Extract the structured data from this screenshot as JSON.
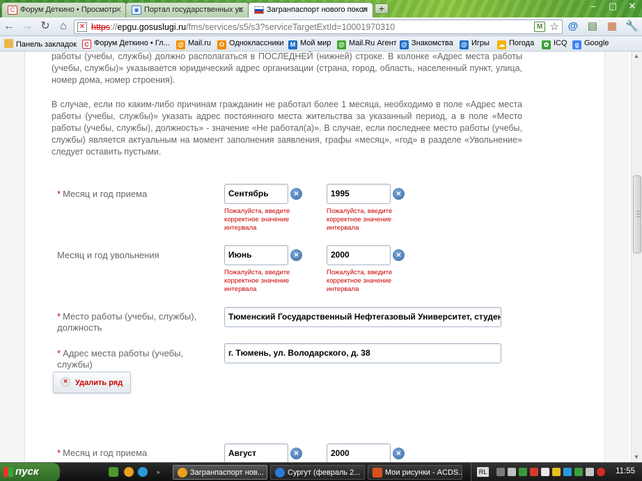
{
  "browser": {
    "tabs": [
      {
        "title": "Форум Деткино • Просмотр",
        "active": false
      },
      {
        "title": "Портал государственных ус",
        "active": false
      },
      {
        "title": "Загранпаспорт нового покол",
        "active": true
      }
    ],
    "new_tab": "+",
    "window_buttons": {
      "minimize": "–",
      "maximize": "▢",
      "close": "✕"
    },
    "nav": {
      "back": "←",
      "forward": "→",
      "reload": "↻",
      "home": "⌂"
    },
    "url": {
      "scheme": "https",
      "separator": "://",
      "host": "epgu.gosuslugi.ru",
      "path": "/fms/services/s5/s3?serviceTargetExtId=10001970310"
    },
    "omnibox_extension": "M",
    "bookmark_star": "☆",
    "toolbar_icons": {
      "mail_agent": "@",
      "chat": "▤",
      "extension": "▦",
      "wrench": "🔧"
    },
    "bookmarks": [
      {
        "label": "Панель закладок",
        "color": "#e8b84a"
      },
      {
        "label": "Форум Деткино • Гл...",
        "color": "#ffffff"
      },
      {
        "label": "Mail.ru",
        "color": "#f29100"
      },
      {
        "label": "Одноклассники",
        "color": "#f28a00"
      },
      {
        "label": "Мой мир",
        "color": "#1e6ec8"
      },
      {
        "label": "Mail.Ru Агент",
        "color": "#41a62a"
      },
      {
        "label": "Знакомства",
        "color": "#1e6ec8"
      },
      {
        "label": "Игры",
        "color": "#1e6ec8"
      },
      {
        "label": "Погода",
        "color": "#f5b400"
      },
      {
        "label": "ICQ",
        "color": "#3aa13a"
      },
      {
        "label": "Google",
        "color": "#4285f4"
      }
    ]
  },
  "page": {
    "paragraph1": "работы (учебы, службы) должно располагаться в ПОСЛЕДНЕЙ (нижней) строке. В колонке «Адрес места работы (учебы, службы)» указывается юридический адрес организации (страна, город, область, населенный пункт, улица, номер дома, номер строения).",
    "paragraph2": "В случае, если по каким-либо причинам гражданин не работал более 1 месяца, необходимо в поле «Адрес места работы (учебы, службы)» указать адрес постоянного места жительства за указанный период, а в поле «Место работы (учебы, службы), должность» - значение «Не работал(а)». В случае, если последнее место работы (учебы, службы) является актуальным на момент заполнения заявления, графы «месяц», «год» в разделе «Увольнение» следует оставить пустыми.",
    "required_mark": "*",
    "clear_glyph": "×",
    "error_text": "Пожалуйста, введите корректное значение интервала",
    "block1": {
      "hire_label": "Месяц и год приема",
      "hire_month": "Сентябрь",
      "hire_year": "1995",
      "fire_label": "Месяц и год увольнения",
      "fire_month": "Июнь",
      "fire_year": "2000",
      "workplace_label": "Место работы (учебы, службы), должность",
      "workplace_value": "Тюменский Государственный Нефтегазовый Университет, студент",
      "address_label": "Адрес места работы (учебы, службы)",
      "address_value": "г. Тюмень, ул. Володарского, д. 38",
      "delete_row": "Удалить ряд",
      "delete_glyph": "×"
    },
    "block2": {
      "hire_label": "Месяц и год приема",
      "hire_month": "Август",
      "hire_year": "2000"
    }
  },
  "taskbar": {
    "start": "пуск",
    "items": [
      {
        "label": "Загранпаспорт нов...",
        "active": true,
        "color": "#e8a020"
      },
      {
        "label": "Сургут (февраль 2...",
        "active": false,
        "color": "#2a7ad8"
      },
      {
        "label": "Мои рисунки - ACDS...",
        "active": false,
        "color": "#d85020"
      }
    ],
    "language": "RL",
    "clock": "11:55"
  }
}
